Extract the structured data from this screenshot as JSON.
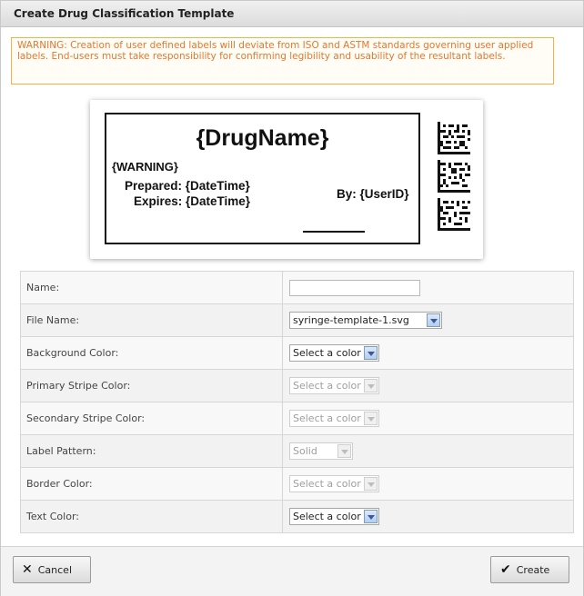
{
  "dialog": {
    "title": "Create Drug Classification Template",
    "warning": "WARNING: Creation of user defined labels will deviate from ISO and ASTM standards governing user applied labels. End-users must take responsibility for confirming legibility and usability of the resultant labels."
  },
  "label_preview": {
    "drug_name": "{DrugName}",
    "warning": "{WARNING}",
    "prepared": "Prepared: {DateTime}",
    "expires": "Expires: {DateTime}",
    "by": "By: {UserID}"
  },
  "form": {
    "rows": [
      {
        "label": "Name:",
        "value": "",
        "kind": "text"
      },
      {
        "label": "File Name:",
        "value": "syringe-template-1.svg",
        "kind": "select"
      },
      {
        "label": "Background Color:",
        "value": "Select a color",
        "kind": "select"
      },
      {
        "label": "Primary Stripe Color:",
        "value": "Select a color",
        "kind": "select-disabled"
      },
      {
        "label": "Secondary Stripe Color:",
        "value": "Select a color",
        "kind": "select-disabled"
      },
      {
        "label": "Label Pattern:",
        "value": "Solid",
        "kind": "select-disabled"
      },
      {
        "label": "Border Color:",
        "value": "Select a color",
        "kind": "select-disabled"
      },
      {
        "label": "Text Color:",
        "value": "Select a color",
        "kind": "select"
      }
    ]
  },
  "footer": {
    "cancel_label": "Cancel",
    "create_label": "Create"
  },
  "icons": {
    "cancel": "close-icon",
    "create": "checkmark-icon",
    "barcode": "datamatrix-barcode-icon"
  },
  "colors": {
    "warning_text": "#e8762b",
    "warning_border": "#f2b24a",
    "select_arrow": "#3b5998"
  }
}
